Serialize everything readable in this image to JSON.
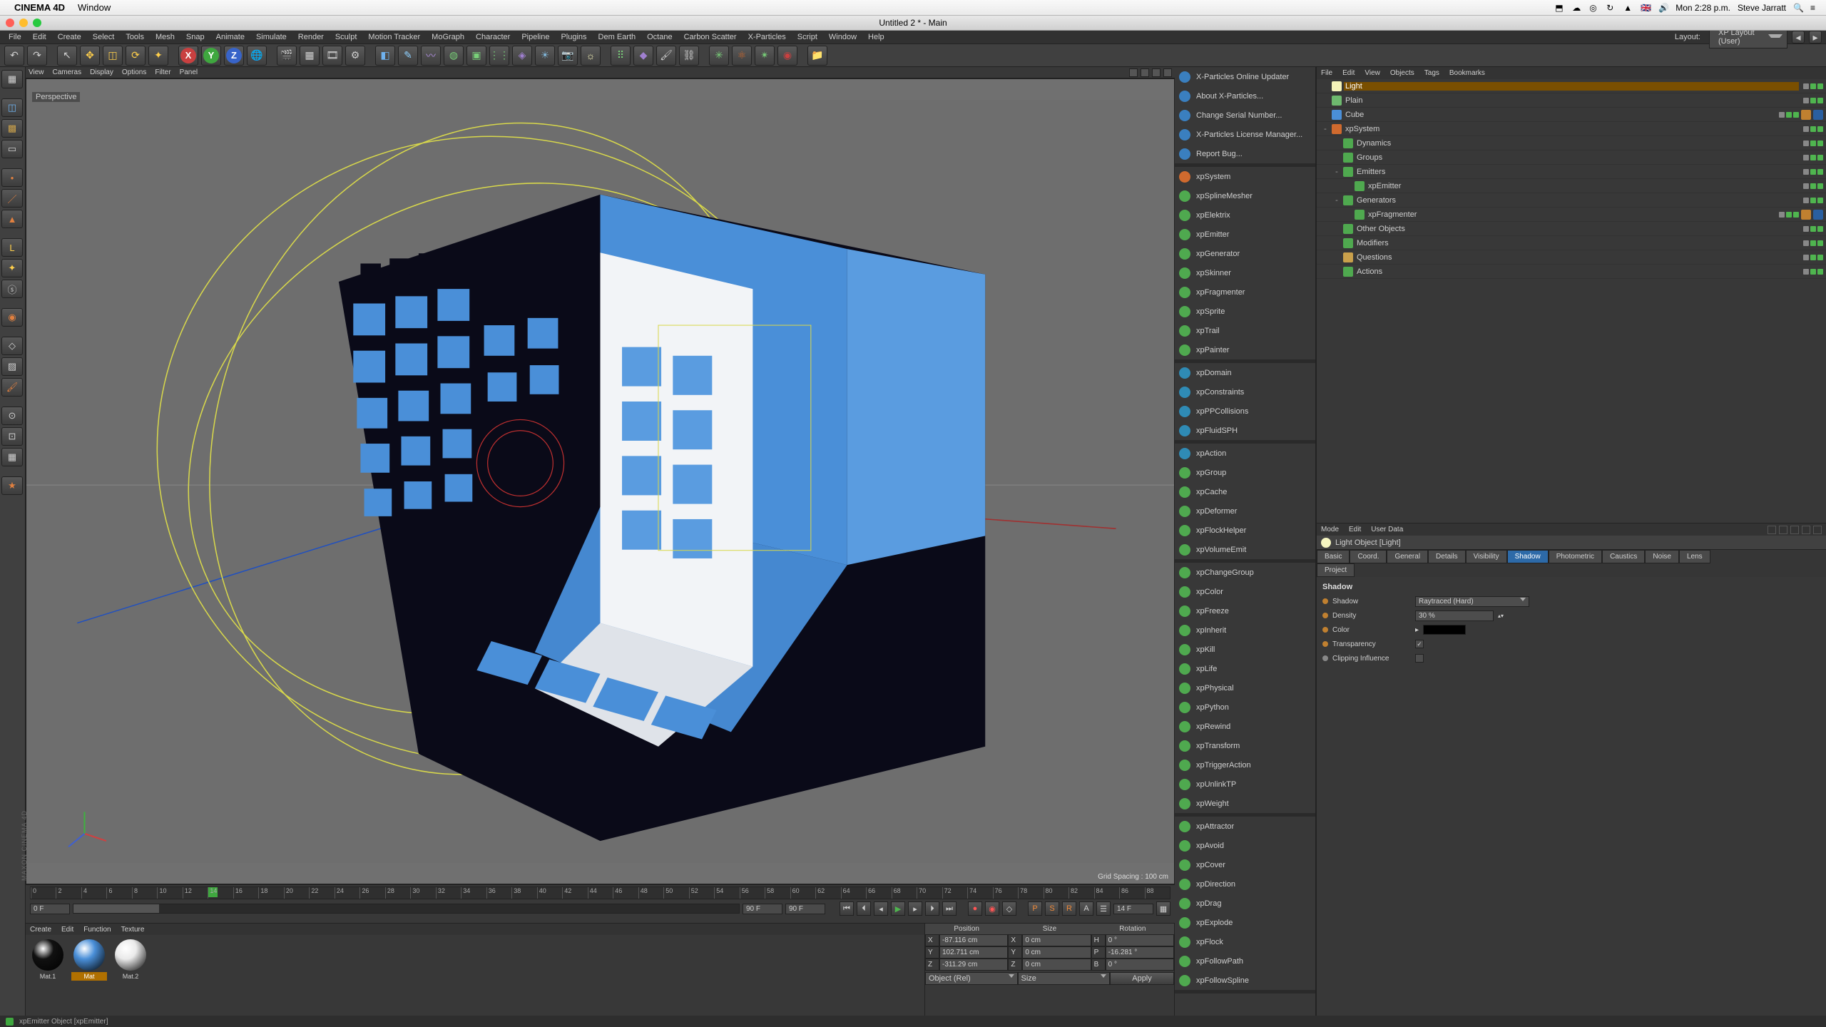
{
  "mac_menu": {
    "app": "CINEMA 4D",
    "items": [
      "Window"
    ],
    "right": {
      "flag": "🇬🇧",
      "clock": "Mon 2:28 p.m.",
      "user": "Steve Jarratt"
    }
  },
  "window": {
    "title": "Untitled 2 * - Main"
  },
  "main_menu": [
    "File",
    "Edit",
    "Create",
    "Select",
    "Tools",
    "Mesh",
    "Snap",
    "Animate",
    "Simulate",
    "Render",
    "Sculpt",
    "Motion Tracker",
    "MoGraph",
    "Character",
    "Pipeline",
    "Plugins",
    "Dem Earth",
    "Octane",
    "Carbon Scatter",
    "X-Particles",
    "Script",
    "Window",
    "Help"
  ],
  "layout_selector": "XP Layout (User)",
  "viewport": {
    "menus": [
      "View",
      "Cameras",
      "Display",
      "Options",
      "Filter",
      "Panel"
    ],
    "label": "Perspective",
    "grid_info": "Grid Spacing : 100 cm"
  },
  "timeline": {
    "start": "0 F",
    "end": "90 F",
    "current": "14 F",
    "min": 0,
    "max": 90,
    "marker": 14
  },
  "material_panel": {
    "menus": [
      "Create",
      "Edit",
      "Function",
      "Texture"
    ],
    "materials": [
      {
        "name": "Mat.1",
        "color": "#111",
        "selected": false
      },
      {
        "name": "Mat",
        "color": "#4a8fd8",
        "selected": true
      },
      {
        "name": "Mat.2",
        "color": "#eaeaea",
        "selected": false
      }
    ]
  },
  "coords": {
    "headers": [
      "Position",
      "Size",
      "Rotation"
    ],
    "rows": [
      {
        "a": "X",
        "av": "-87.116 cm",
        "b": "X",
        "bv": "0 cm",
        "c": "H",
        "cv": "0 °"
      },
      {
        "a": "Y",
        "av": "102.711 cm",
        "b": "Y",
        "bv": "0 cm",
        "c": "P",
        "cv": "-16.281 °"
      },
      {
        "a": "Z",
        "av": "-311.29 cm",
        "b": "Z",
        "bv": "0 cm",
        "c": "B",
        "cv": "0 °"
      }
    ],
    "mode1": "Object (Rel)",
    "mode2": "Size",
    "apply": "Apply"
  },
  "xp_list": [
    {
      "group": [
        {
          "label": "X-Particles Online Updater",
          "c": "#3a7fbf"
        },
        {
          "label": "About X-Particles...",
          "c": "#3a7fbf"
        },
        {
          "label": "Change Serial Number...",
          "c": "#3a7fbf"
        },
        {
          "label": "X-Particles License Manager...",
          "c": "#3a7fbf"
        },
        {
          "label": "Report Bug...",
          "c": "#3a7fbf"
        }
      ]
    },
    {
      "group": [
        {
          "label": "xpSystem",
          "c": "#d06a2e"
        },
        {
          "label": "xpSplineMesher",
          "c": "#4fa94f"
        },
        {
          "label": "xpElektrix",
          "c": "#4fa94f"
        },
        {
          "label": "xpEmitter",
          "c": "#4fa94f"
        },
        {
          "label": "xpGenerator",
          "c": "#4fa94f"
        },
        {
          "label": "xpSkinner",
          "c": "#4fa94f"
        },
        {
          "label": "xpFragmenter",
          "c": "#4fa94f"
        },
        {
          "label": "xpSprite",
          "c": "#4fa94f"
        },
        {
          "label": "xpTrail",
          "c": "#4fa94f"
        },
        {
          "label": "xpPainter",
          "c": "#4fa94f"
        }
      ]
    },
    {
      "group": [
        {
          "label": "xpDomain",
          "c": "#2f8bb5"
        },
        {
          "label": "xpConstraints",
          "c": "#2f8bb5"
        },
        {
          "label": "xpPPCollisions",
          "c": "#2f8bb5"
        },
        {
          "label": "xpFluidSPH",
          "c": "#2f8bb5"
        }
      ]
    },
    {
      "group": [
        {
          "label": "xpAction",
          "c": "#2f8bb5"
        },
        {
          "label": "xpGroup",
          "c": "#4fa94f"
        },
        {
          "label": "xpCache",
          "c": "#4fa94f"
        },
        {
          "label": "xpDeformer",
          "c": "#4fa94f"
        },
        {
          "label": "xpFlockHelper",
          "c": "#4fa94f"
        },
        {
          "label": "xpVolumeEmit",
          "c": "#4fa94f"
        }
      ]
    },
    {
      "group": [
        {
          "label": "xpChangeGroup",
          "c": "#4fa94f"
        },
        {
          "label": "xpColor",
          "c": "#4fa94f"
        },
        {
          "label": "xpFreeze",
          "c": "#4fa94f"
        },
        {
          "label": "xpInherit",
          "c": "#4fa94f"
        },
        {
          "label": "xpKill",
          "c": "#4fa94f"
        },
        {
          "label": "xpLife",
          "c": "#4fa94f"
        },
        {
          "label": "xpPhysical",
          "c": "#4fa94f"
        },
        {
          "label": "xpPython",
          "c": "#4fa94f"
        },
        {
          "label": "xpRewind",
          "c": "#4fa94f"
        },
        {
          "label": "xpTransform",
          "c": "#4fa94f"
        },
        {
          "label": "xpTriggerAction",
          "c": "#4fa94f"
        },
        {
          "label": "xpUnlinkTP",
          "c": "#4fa94f"
        },
        {
          "label": "xpWeight",
          "c": "#4fa94f"
        }
      ]
    },
    {
      "group": [
        {
          "label": "xpAttractor",
          "c": "#4fa94f"
        },
        {
          "label": "xpAvoid",
          "c": "#4fa94f"
        },
        {
          "label": "xpCover",
          "c": "#4fa94f"
        },
        {
          "label": "xpDirection",
          "c": "#4fa94f"
        },
        {
          "label": "xpDrag",
          "c": "#4fa94f"
        },
        {
          "label": "xpExplode",
          "c": "#4fa94f"
        },
        {
          "label": "xpFlock",
          "c": "#4fa94f"
        },
        {
          "label": "xpFollowPath",
          "c": "#4fa94f"
        },
        {
          "label": "xpFollowSpline",
          "c": "#4fa94f"
        }
      ]
    }
  ],
  "object_manager": {
    "menus": [
      "File",
      "Edit",
      "View",
      "Objects",
      "Tags",
      "Bookmarks"
    ],
    "tree": [
      {
        "d": 0,
        "icon": "#f5f3b8",
        "label": "Light",
        "sel": true,
        "ex": ""
      },
      {
        "d": 0,
        "icon": "#6eb96e",
        "label": "Plain",
        "ex": ""
      },
      {
        "d": 0,
        "icon": "#4a8fd8",
        "label": "Cube",
        "ex": "",
        "extra_tags": 2
      },
      {
        "d": 0,
        "icon": "#d06a2e",
        "label": "xpSystem",
        "ex": "-"
      },
      {
        "d": 1,
        "icon": "#4fa94f",
        "label": "Dynamics",
        "ex": ""
      },
      {
        "d": 1,
        "icon": "#4fa94f",
        "label": "Groups",
        "ex": ""
      },
      {
        "d": 1,
        "icon": "#4fa94f",
        "label": "Emitters",
        "ex": "-"
      },
      {
        "d": 2,
        "icon": "#4fa94f",
        "label": "xpEmitter",
        "ex": ""
      },
      {
        "d": 1,
        "icon": "#4fa94f",
        "label": "Generators",
        "ex": "-"
      },
      {
        "d": 2,
        "icon": "#4fa94f",
        "label": "xpFragmenter",
        "ex": "",
        "extra_tags": 2
      },
      {
        "d": 1,
        "icon": "#4fa94f",
        "label": "Other Objects",
        "ex": ""
      },
      {
        "d": 1,
        "icon": "#4fa94f",
        "label": "Modifiers",
        "ex": ""
      },
      {
        "d": 1,
        "icon": "#c9a04b",
        "label": "Questions",
        "ex": ""
      },
      {
        "d": 1,
        "icon": "#4fa94f",
        "label": "Actions",
        "ex": ""
      }
    ]
  },
  "attributes": {
    "menus": [
      "Mode",
      "Edit",
      "User Data"
    ],
    "title": "Light Object [Light]",
    "tabs_row1": [
      "Basic",
      "Coord.",
      "General",
      "Details",
      "Visibility",
      "Shadow",
      "Photometric",
      "Caustics",
      "Noise",
      "Lens"
    ],
    "tabs_row2": [
      "Project"
    ],
    "active_tab": "Shadow",
    "section_title": "Shadow",
    "params": {
      "shadow_label": "Shadow",
      "shadow_value": "Raytraced (Hard)",
      "density_label": "Density",
      "density_value": "30 %",
      "color_label": "Color",
      "transparency_label": "Transparency",
      "clipping_label": "Clipping Influence"
    }
  },
  "status": {
    "text": "xpEmitter Object [xpEmitter]"
  }
}
